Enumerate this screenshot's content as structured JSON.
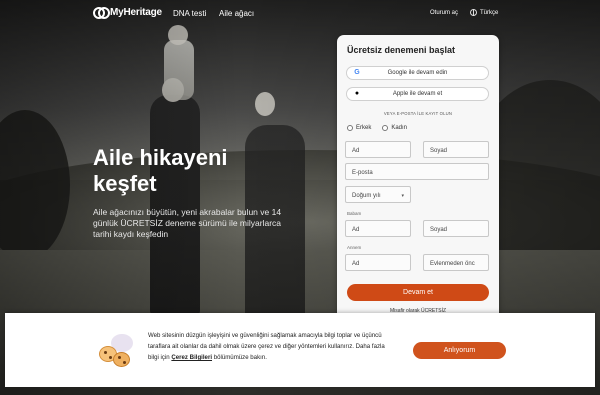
{
  "header": {
    "logo_text": "MyHeritage",
    "nav": [
      "DNA testi",
      "Aile ağacı"
    ],
    "signin": "Oturum aç",
    "language": "Türkçe"
  },
  "hero": {
    "title": "Aile hikayeni keşfet",
    "subtitle": "Aile ağacınızı büyütün, yeni akrabalar bulun ve 14 günlük ÜCRETSİZ deneme sürümü ile milyarlarca tarihi kaydı keşfedin"
  },
  "signup": {
    "title": "Ücretsiz denemeni başlat",
    "google_button": "Google ile devam edin",
    "apple_button": "Apple ile devam et",
    "divider": "VEYA E-POSTA İLE KAYIT OLUN",
    "gender_options": [
      "Erkek",
      "Kadın"
    ],
    "first_name_placeholder": "Ad",
    "last_name_placeholder": "Soyad",
    "email_placeholder": "E-posta",
    "birth_year_placeholder": "Doğum yılı",
    "father_label": "Babam",
    "father_first_placeholder": "Ad",
    "father_last_placeholder": "Soyad",
    "mother_label": "Annem",
    "mother_first_placeholder": "Ad",
    "mother_last_placeholder": "Evlenmeden önc",
    "submit": "Devam et",
    "link_text": "Misafir olarak ÜCRETSİZ"
  },
  "cookie_banner": {
    "text_before": "Web sitesinin düzgün işleyişini ve güvenliğini sağlamak amacıyla bilgi toplar ve üçüncü taraflara ait olanlar da dahil olmak üzere çerez ve diğer yöntemleri kullanırız. Daha fazla bilgi için ",
    "link": "Çerez Bilgileri",
    "text_after": " bölümümüze bakın.",
    "accept": "Anlıyorum"
  },
  "colors": {
    "accent": "#cf4a16",
    "card_bg": "#f7f7f7"
  },
  "icons": {
    "google": "google-icon",
    "apple": "apple-icon",
    "globe": "globe-icon",
    "logo": "myheritage-logo-icon",
    "cookie": "cookie-illustration-icon"
  }
}
